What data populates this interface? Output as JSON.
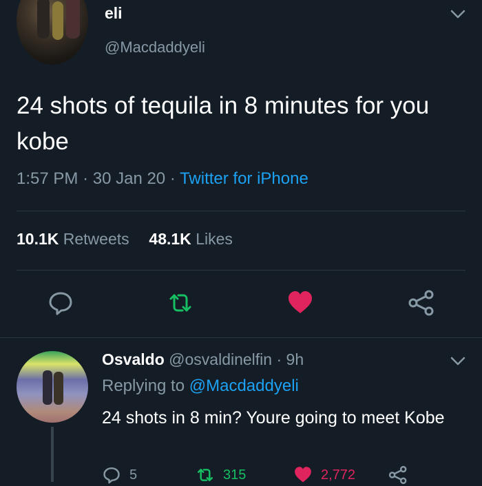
{
  "tweet": {
    "display_name": "eli",
    "handle": "@Macdaddyeli",
    "text": "24 shots of tequila in 8 minutes for you kobe",
    "time": "1:57 PM",
    "date": "30 Jan 20",
    "source": "Twitter for iPhone",
    "retweets_count": "10.1K",
    "retweets_label": "Retweets",
    "likes_count": "48.1K",
    "likes_label": "Likes",
    "icons": [
      "avatar",
      "chevron-down-icon",
      "reply-icon",
      "retweet-icon",
      "heart-icon",
      "share-icon"
    ]
  },
  "reply": {
    "display_name": "Osvaldo",
    "handle": "@osvaldinelfin",
    "time": "9h",
    "replying_label": "Replying to",
    "replying_to": "@Macdaddyeli",
    "text": "24 shots in 8 min? Youre going to meet Kobe",
    "reply_count": "5",
    "retweet_count": "315",
    "like_count": "2,772"
  },
  "colors": {
    "background": "#141d26",
    "text": "#ffffff",
    "secondary": "#8899a6",
    "link": "#1da1f2",
    "retweet": "#17bf63",
    "like": "#e0245e"
  }
}
